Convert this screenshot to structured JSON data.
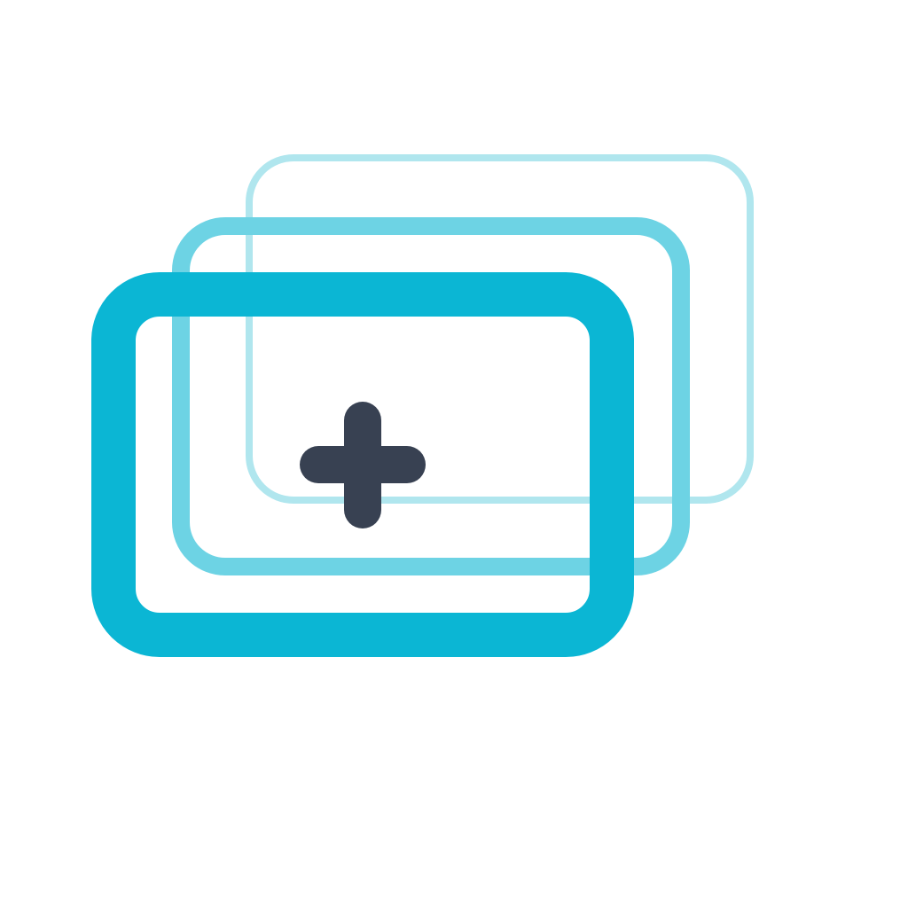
{
  "icon": {
    "name": "add-stacked-cards-icon",
    "colors": {
      "background": "#ffffff",
      "card_back": "#b0e6ee",
      "card_middle": "#6dd3e4",
      "card_front": "#0bb6d4",
      "plus": "#384152"
    }
  }
}
